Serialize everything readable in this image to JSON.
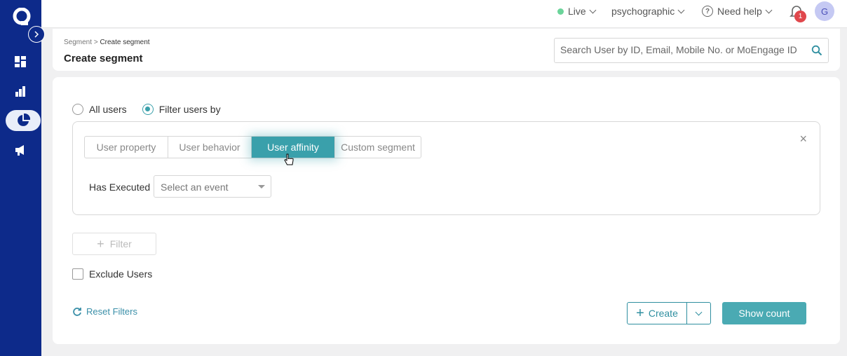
{
  "topbar": {
    "env_label": "Live",
    "workspace_label": "psychographic",
    "help_label": "Need help",
    "notification_count": "1",
    "avatar_initial": "G"
  },
  "header": {
    "breadcrumb_parent": "Segment",
    "breadcrumb_separator": ">",
    "breadcrumb_current": "Create segment",
    "title": "Create segment",
    "search_placeholder": "Search User by ID, Email, Mobile No. or MoEngage ID"
  },
  "audience": {
    "option_all": "All users",
    "option_filter": "Filter users by",
    "selected": "Filter users by"
  },
  "filter": {
    "tabs": [
      {
        "label": "User property"
      },
      {
        "label": "User behavior"
      },
      {
        "label": "User affinity"
      },
      {
        "label": "Custom segment"
      }
    ],
    "active_tab": "User affinity",
    "close_label": "×",
    "has_executed_label": "Has Executed",
    "event_placeholder": "Select an event"
  },
  "actions": {
    "add_filter_label": "Filter",
    "exclude_label": "Exclude Users",
    "reset_label": "Reset Filters",
    "create_label": "Create",
    "show_count_label": "Show count"
  },
  "colors": {
    "sidebar": "#0d2a8a",
    "accent": "#3aa0ab",
    "badge": "#e0474c"
  }
}
